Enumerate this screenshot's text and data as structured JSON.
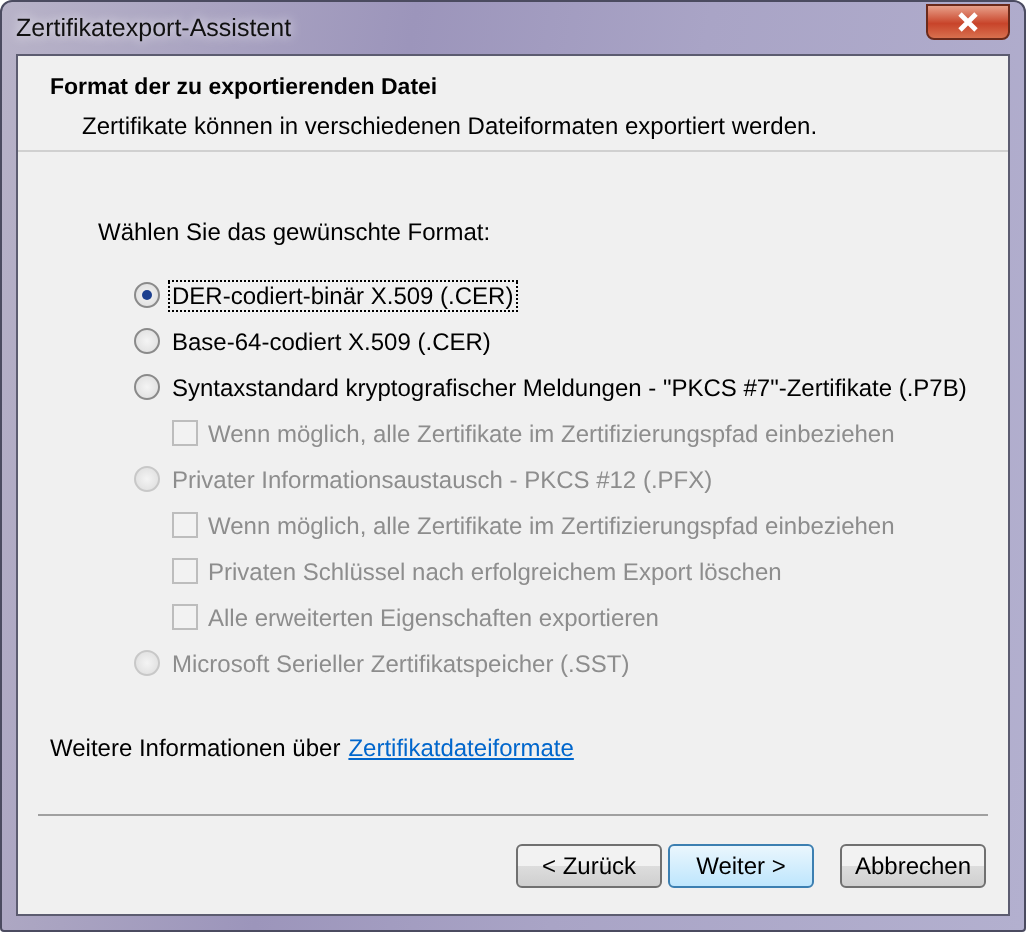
{
  "window": {
    "title": "Zertifikatexport-Assistent"
  },
  "header": {
    "title": "Format der zu exportierenden Datei",
    "subtitle": "Zertifikate können in verschiedenen Dateiformaten exportiert werden."
  },
  "prompt": "Wählen Sie das gewünschte Format:",
  "options": [
    {
      "label": "DER-codiert-binär X.509 (.CER)",
      "selected": true,
      "disabled": false,
      "focused": true
    },
    {
      "label": "Base-64-codiert X.509 (.CER)",
      "selected": false,
      "disabled": false,
      "focused": false
    },
    {
      "label": "Syntaxstandard kryptografischer Meldungen - \"PKCS #7\"-Zertifikate (.P7B)",
      "selected": false,
      "disabled": false,
      "focused": false,
      "children": [
        {
          "label": "Wenn möglich, alle Zertifikate im Zertifizierungspfad einbeziehen",
          "checked": false,
          "disabled": true
        }
      ]
    },
    {
      "label": "Privater Informationsaustausch - PKCS #12 (.PFX)",
      "selected": false,
      "disabled": true,
      "focused": false,
      "children": [
        {
          "label": "Wenn möglich, alle Zertifikate im Zertifizierungspfad einbeziehen",
          "checked": false,
          "disabled": true
        },
        {
          "label": "Privaten Schlüssel nach erfolgreichem Export löschen",
          "checked": false,
          "disabled": true
        },
        {
          "label": "Alle erweiterten Eigenschaften exportieren",
          "checked": false,
          "disabled": true
        }
      ]
    },
    {
      "label": "Microsoft Serieller Zertifikatspeicher (.SST)",
      "selected": false,
      "disabled": true,
      "focused": false
    }
  ],
  "info": {
    "text": "Weitere Informationen über",
    "link": "Zertifikatdateiformate"
  },
  "buttons": [
    {
      "label": "< Zurück",
      "default": false
    },
    {
      "label": "Weiter >",
      "default": true
    },
    {
      "label": "Abbrechen",
      "default": false
    }
  ]
}
